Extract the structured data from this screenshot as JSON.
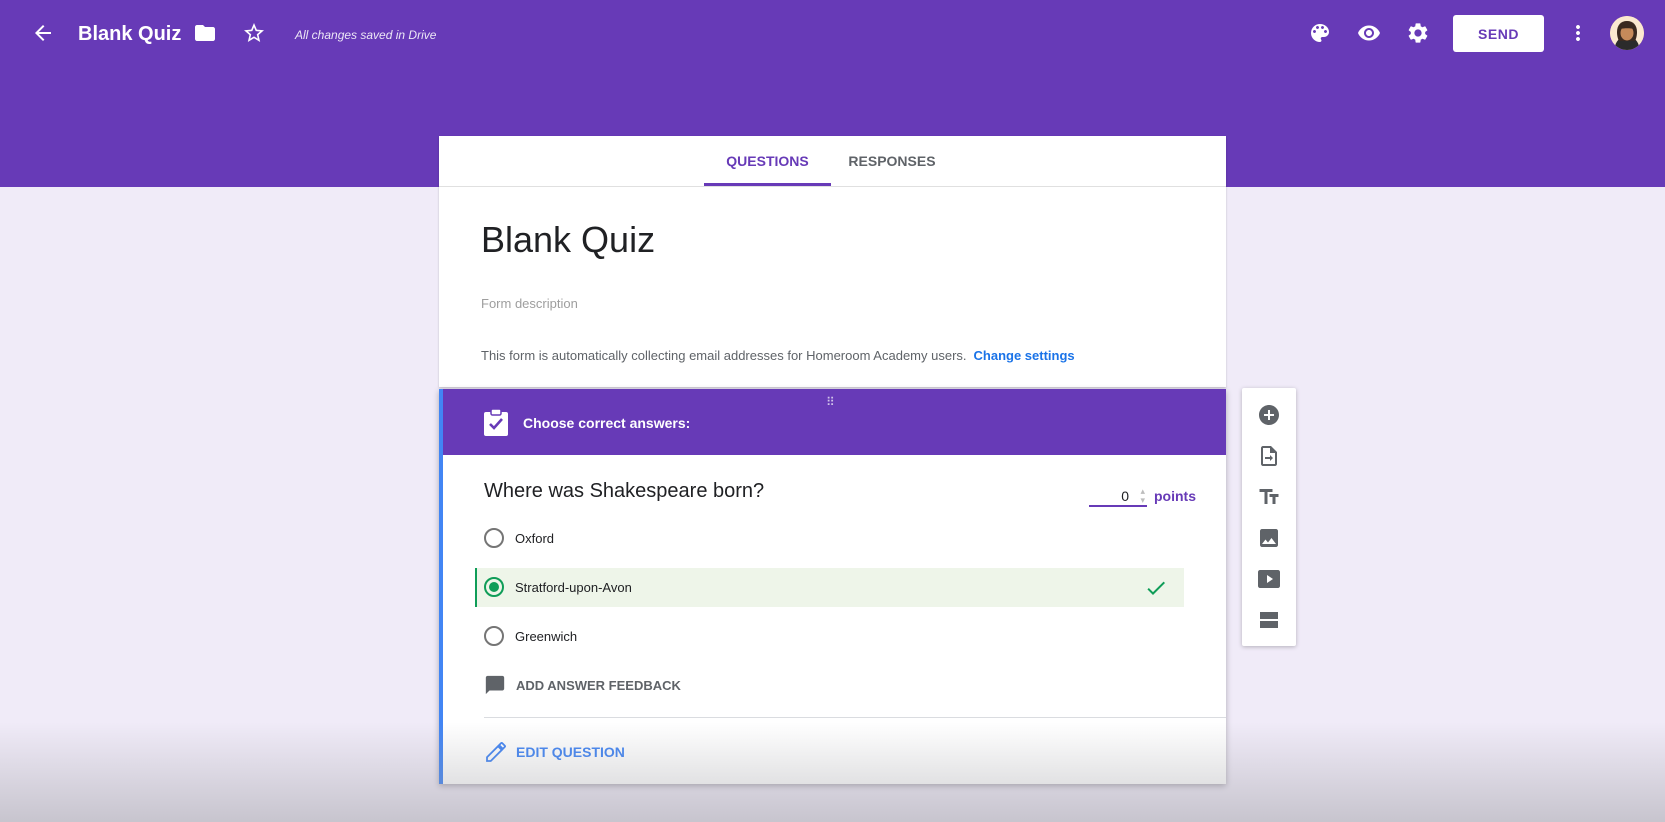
{
  "header": {
    "doc_title": "Blank Quiz",
    "saved_note": "All changes saved in Drive",
    "send_label": "SEND",
    "icons": [
      "back-arrow-icon",
      "folder-icon",
      "star-icon",
      "palette-icon",
      "eye-icon",
      "gear-icon",
      "more-vert-icon",
      "avatar"
    ]
  },
  "tabs": [
    {
      "label": "QUESTIONS",
      "active": true
    },
    {
      "label": "RESPONSES",
      "active": false
    }
  ],
  "form": {
    "title": "Blank Quiz",
    "description_placeholder": "Form description",
    "email_note": "This form is automatically collecting email addresses for Homeroom Academy users.",
    "change_settings": "Change settings"
  },
  "question": {
    "header_label": "Choose correct answers:",
    "text": "Where was Shakespeare born?",
    "points_value": "0",
    "points_label": "points",
    "options": [
      {
        "label": "Oxford",
        "correct": false
      },
      {
        "label": "Stratford-upon-Avon",
        "correct": true
      },
      {
        "label": "Greenwich",
        "correct": false
      }
    ],
    "feedback_label": "ADD ANSWER FEEDBACK",
    "edit_label": "EDIT QUESTION"
  },
  "toolbar": [
    "add-question-icon",
    "import-questions-icon",
    "add-title-icon",
    "add-image-icon",
    "add-video-icon",
    "add-section-icon"
  ],
  "colors": {
    "accent": "#673ab7",
    "background": "#f0ebf8",
    "correct": "#0f9d58",
    "link": "#1a73e8",
    "edit_border": "#4285f4"
  }
}
